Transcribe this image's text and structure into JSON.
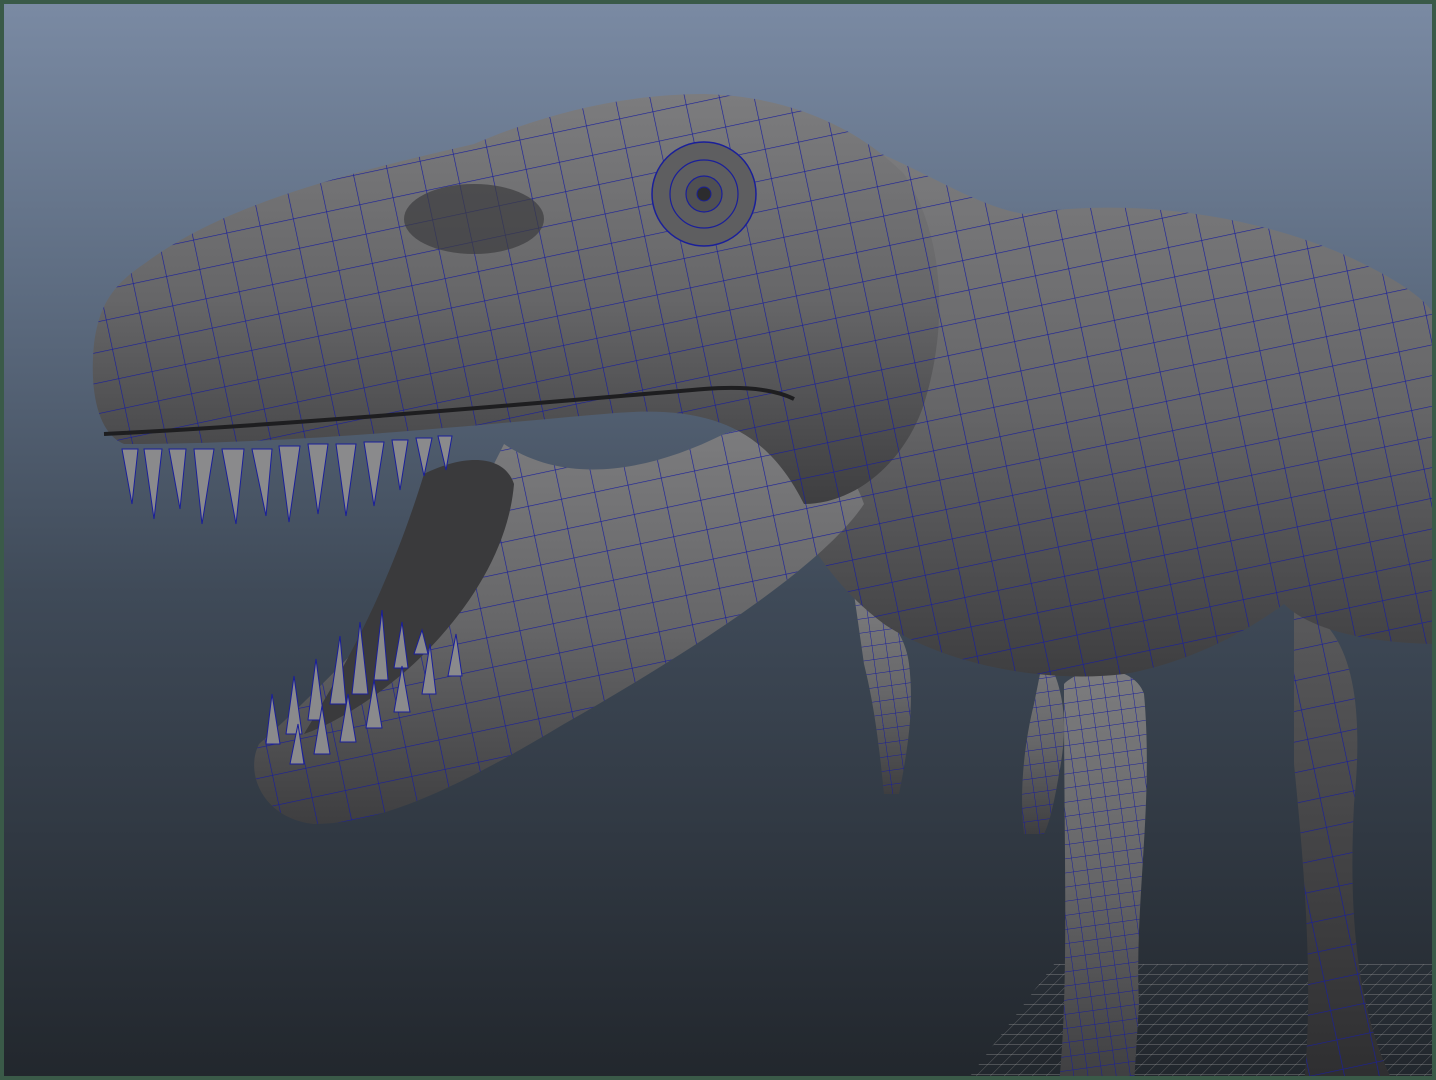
{
  "viewport": {
    "background_top": "#7a8aa3",
    "background_bottom": "#22272d",
    "frame_color": "#3a5a48",
    "wireframe_color": "#1a1f9a",
    "surface_color": "#6a6a6c"
  },
  "scene": {
    "model_icon": "trex-model-icon",
    "ground_grid_icon": "ground-grid-icon"
  }
}
